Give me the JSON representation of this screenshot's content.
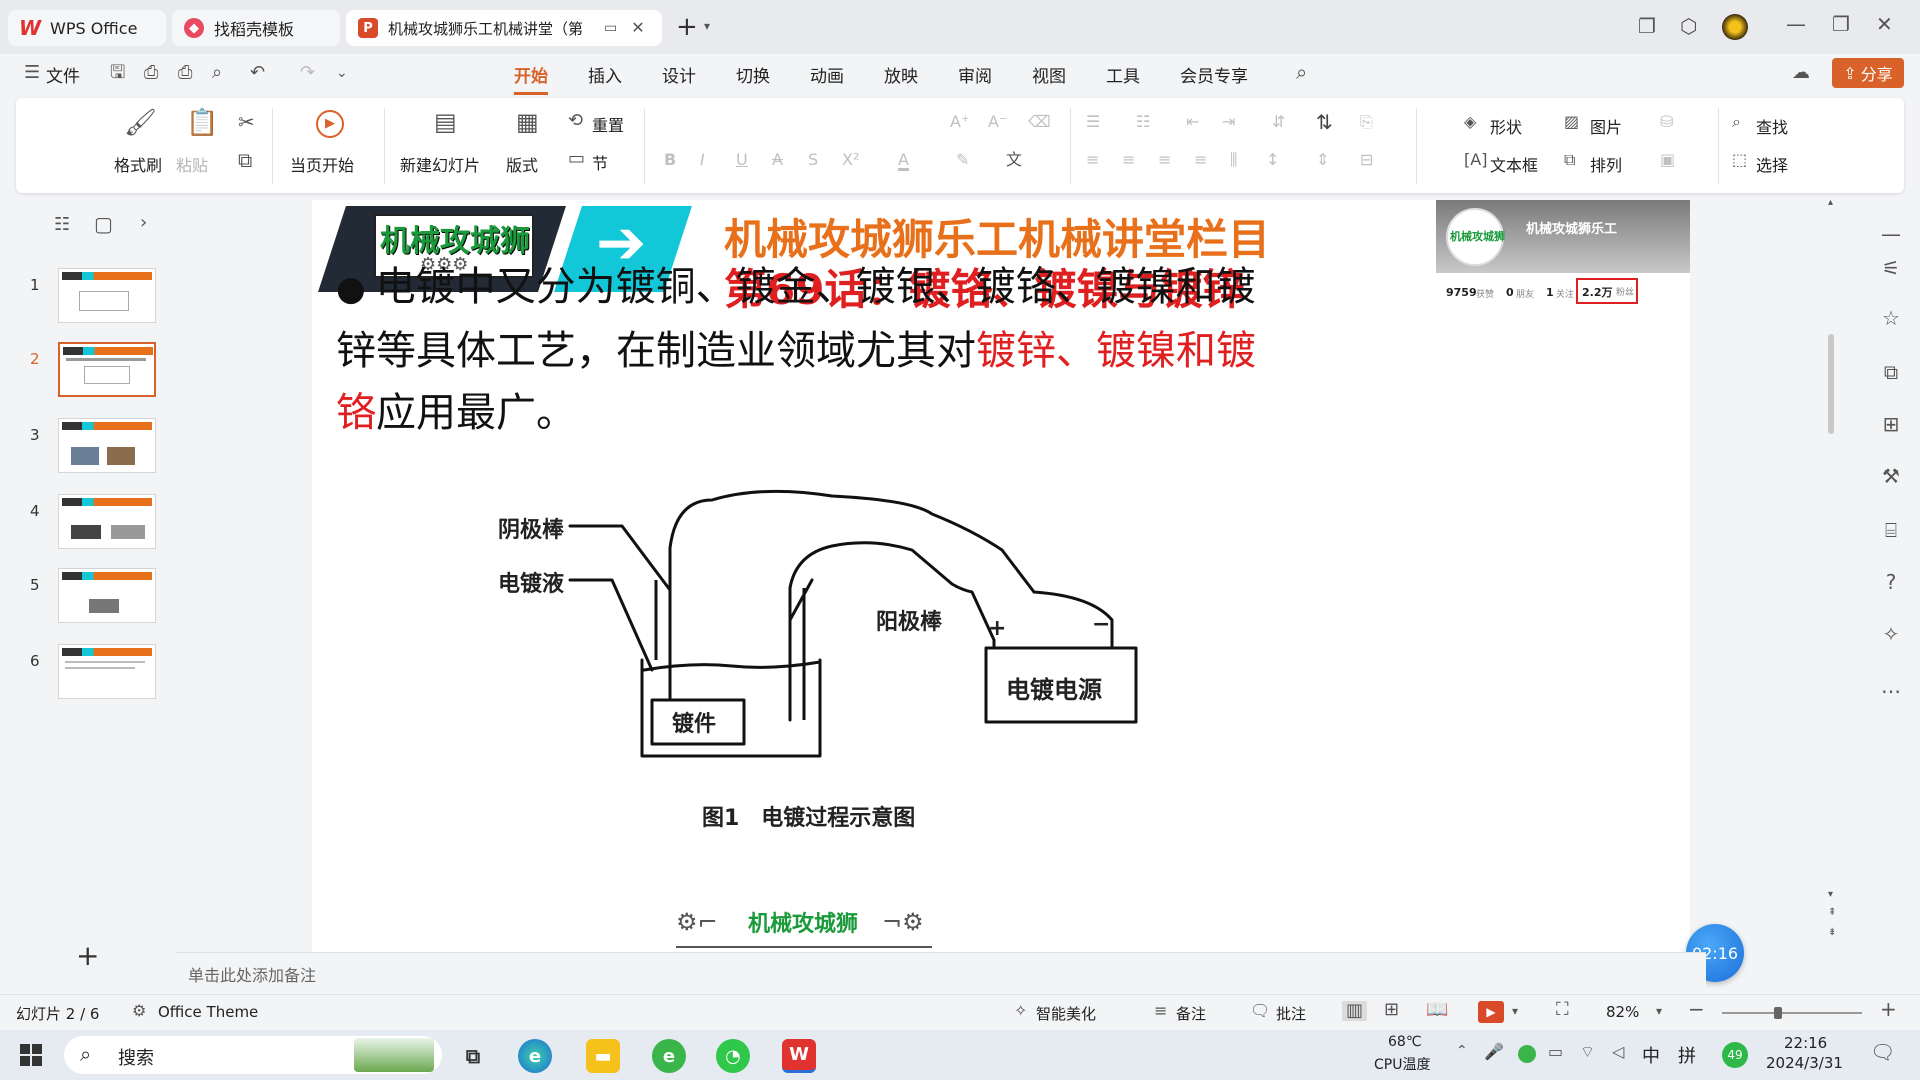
{
  "titlebar": {
    "tabs": [
      {
        "label": "WPS Office"
      },
      {
        "label": "找稻壳模板"
      },
      {
        "label": "机械攻城狮乐工机械讲堂（第"
      }
    ],
    "new_tab": "+"
  },
  "menubar": {
    "file": "文件",
    "tabs": [
      "开始",
      "插入",
      "设计",
      "切换",
      "动画",
      "放映",
      "审阅",
      "视图",
      "工具",
      "会员专享"
    ],
    "active_tab": "开始",
    "share": "分享"
  },
  "ribbon": {
    "format_painter": "格式刷",
    "paste": "粘贴",
    "from_current": "当页开始",
    "new_slide": "新建幻灯片",
    "layout": "版式",
    "reset": "重置",
    "section": "节",
    "shape": "形状",
    "picture": "图片",
    "textbox": "文本框",
    "arrange": "排列",
    "find": "查找",
    "select": "选择"
  },
  "slides_panel": {
    "numbers": [
      "1",
      "2",
      "3",
      "4",
      "5",
      "6"
    ],
    "active": 2,
    "add": "+"
  },
  "slide": {
    "logo_text": "机械攻城狮",
    "banner_title": "机械攻城狮乐工机械讲堂栏目",
    "banner_subtitle": "第69话：镀铬、镀镍与镀锌",
    "profile": {
      "name": "机械攻城狮乐工",
      "likes": "9759",
      "likes_label": "获赞",
      "friends": "0",
      "friends_label": "朋友",
      "following": "1",
      "following_label": "关注",
      "fans": "2.2万",
      "fans_label": "粉丝"
    },
    "bullet": "●",
    "body_part1": "电镀中又分为镀铜、镀金、镀银、镀铬、镀镍和镀锌等具体工艺，在制造业领域尤其对",
    "body_highlight": "镀锌、镀镍和镀铬",
    "body_part2": "应用最广。",
    "diagram": {
      "label_cathode": "阴极棒",
      "label_solution": "电镀液",
      "label_anode": "阳极棒",
      "label_workpiece": "镀件",
      "label_power": "电镀电源",
      "plus": "+",
      "minus": "−",
      "caption": "图1　电镀过程示意图"
    }
  },
  "notes_placeholder": "单击此处添加备注",
  "status": {
    "slide_info": "幻灯片 2 / 6",
    "theme": "Office Theme",
    "smart": "智能美化",
    "notes": "备注",
    "comment": "批注",
    "zoom": "82%",
    "timer": "02:16"
  },
  "taskbar": {
    "search": "搜索",
    "temp": "68℃",
    "temp_label": "CPU温度",
    "ime": "中",
    "ime2": "拼",
    "badge": "49",
    "time": "22:16",
    "date": "2024/3/31"
  },
  "colors": {
    "accent": "#d9622b",
    "banner_orange": "#e8701a",
    "banner_red": "#e02020",
    "highlight_red": "#e02020",
    "teal": "#12c8d8",
    "dark": "#222a35"
  }
}
